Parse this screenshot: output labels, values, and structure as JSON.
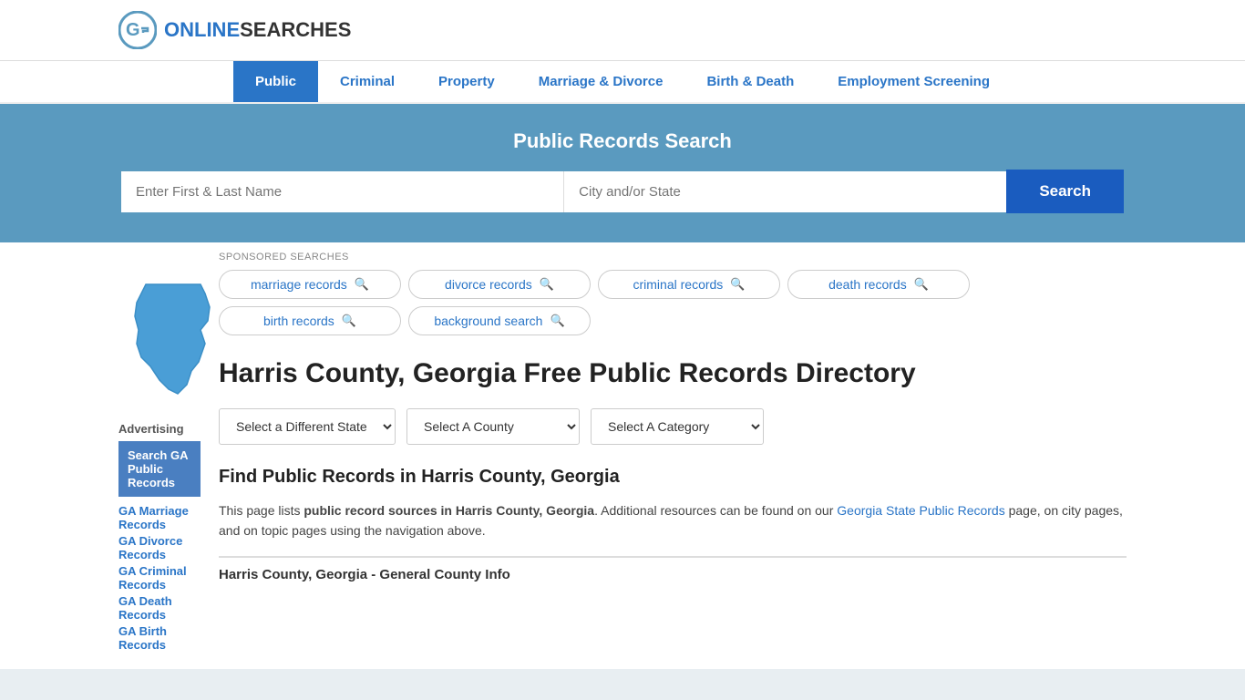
{
  "header": {
    "logo_text_part1": "ONLINE",
    "logo_text_part2": "SEARCHES"
  },
  "nav": {
    "items": [
      {
        "label": "Public",
        "active": true
      },
      {
        "label": "Criminal",
        "active": false
      },
      {
        "label": "Property",
        "active": false
      },
      {
        "label": "Marriage & Divorce",
        "active": false
      },
      {
        "label": "Birth & Death",
        "active": false
      },
      {
        "label": "Employment Screening",
        "active": false
      }
    ]
  },
  "hero": {
    "title": "Public Records Search",
    "name_placeholder": "Enter First & Last Name",
    "location_placeholder": "City and/or State",
    "search_button": "Search"
  },
  "sponsored": {
    "label": "SPONSORED SEARCHES",
    "tags": [
      {
        "label": "marriage records"
      },
      {
        "label": "divorce records"
      },
      {
        "label": "criminal records"
      },
      {
        "label": "death records"
      },
      {
        "label": "birth records"
      },
      {
        "label": "background search"
      }
    ]
  },
  "page": {
    "title": "Harris County, Georgia Free Public Records Directory"
  },
  "dropdowns": {
    "state_label": "Select a Different State",
    "county_label": "Select A County",
    "category_label": "Select A Category"
  },
  "find_section": {
    "title": "Find Public Records in Harris County, Georgia",
    "text_part1": "This page lists ",
    "text_bold": "public record sources in Harris County, Georgia",
    "text_part2": ". Additional resources can be found on our ",
    "link_text": "Georgia State Public Records",
    "text_part3": " page, on city pages, and on topic pages using the navigation above."
  },
  "divider": {
    "title": "Harris County, Georgia - General County Info"
  },
  "sidebar": {
    "ad_title": "Advertising",
    "ad_box_text": "Search GA Public Records",
    "links": [
      {
        "label": "GA Marriage Records"
      },
      {
        "label": "GA Divorce Records"
      },
      {
        "label": "GA Criminal Records"
      },
      {
        "label": "GA Death Records"
      },
      {
        "label": "GA Birth Records"
      }
    ]
  }
}
